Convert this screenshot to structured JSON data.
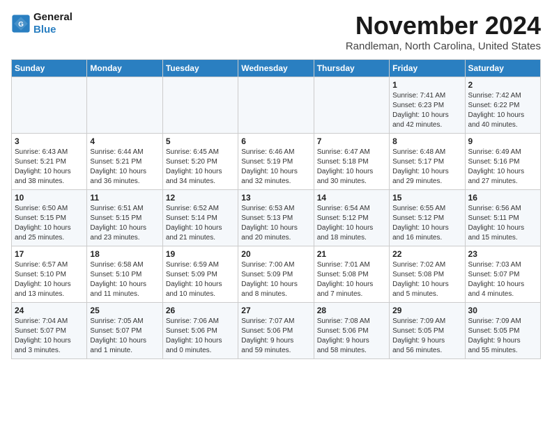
{
  "logo": {
    "line1": "General",
    "line2": "Blue"
  },
  "title": "November 2024",
  "location": "Randleman, North Carolina, United States",
  "days_of_week": [
    "Sunday",
    "Monday",
    "Tuesday",
    "Wednesday",
    "Thursday",
    "Friday",
    "Saturday"
  ],
  "weeks": [
    [
      {
        "day": "",
        "info": ""
      },
      {
        "day": "",
        "info": ""
      },
      {
        "day": "",
        "info": ""
      },
      {
        "day": "",
        "info": ""
      },
      {
        "day": "",
        "info": ""
      },
      {
        "day": "1",
        "info": "Sunrise: 7:41 AM\nSunset: 6:23 PM\nDaylight: 10 hours\nand 42 minutes."
      },
      {
        "day": "2",
        "info": "Sunrise: 7:42 AM\nSunset: 6:22 PM\nDaylight: 10 hours\nand 40 minutes."
      }
    ],
    [
      {
        "day": "3",
        "info": "Sunrise: 6:43 AM\nSunset: 5:21 PM\nDaylight: 10 hours\nand 38 minutes."
      },
      {
        "day": "4",
        "info": "Sunrise: 6:44 AM\nSunset: 5:21 PM\nDaylight: 10 hours\nand 36 minutes."
      },
      {
        "day": "5",
        "info": "Sunrise: 6:45 AM\nSunset: 5:20 PM\nDaylight: 10 hours\nand 34 minutes."
      },
      {
        "day": "6",
        "info": "Sunrise: 6:46 AM\nSunset: 5:19 PM\nDaylight: 10 hours\nand 32 minutes."
      },
      {
        "day": "7",
        "info": "Sunrise: 6:47 AM\nSunset: 5:18 PM\nDaylight: 10 hours\nand 30 minutes."
      },
      {
        "day": "8",
        "info": "Sunrise: 6:48 AM\nSunset: 5:17 PM\nDaylight: 10 hours\nand 29 minutes."
      },
      {
        "day": "9",
        "info": "Sunrise: 6:49 AM\nSunset: 5:16 PM\nDaylight: 10 hours\nand 27 minutes."
      }
    ],
    [
      {
        "day": "10",
        "info": "Sunrise: 6:50 AM\nSunset: 5:15 PM\nDaylight: 10 hours\nand 25 minutes."
      },
      {
        "day": "11",
        "info": "Sunrise: 6:51 AM\nSunset: 5:15 PM\nDaylight: 10 hours\nand 23 minutes."
      },
      {
        "day": "12",
        "info": "Sunrise: 6:52 AM\nSunset: 5:14 PM\nDaylight: 10 hours\nand 21 minutes."
      },
      {
        "day": "13",
        "info": "Sunrise: 6:53 AM\nSunset: 5:13 PM\nDaylight: 10 hours\nand 20 minutes."
      },
      {
        "day": "14",
        "info": "Sunrise: 6:54 AM\nSunset: 5:12 PM\nDaylight: 10 hours\nand 18 minutes."
      },
      {
        "day": "15",
        "info": "Sunrise: 6:55 AM\nSunset: 5:12 PM\nDaylight: 10 hours\nand 16 minutes."
      },
      {
        "day": "16",
        "info": "Sunrise: 6:56 AM\nSunset: 5:11 PM\nDaylight: 10 hours\nand 15 minutes."
      }
    ],
    [
      {
        "day": "17",
        "info": "Sunrise: 6:57 AM\nSunset: 5:10 PM\nDaylight: 10 hours\nand 13 minutes."
      },
      {
        "day": "18",
        "info": "Sunrise: 6:58 AM\nSunset: 5:10 PM\nDaylight: 10 hours\nand 11 minutes."
      },
      {
        "day": "19",
        "info": "Sunrise: 6:59 AM\nSunset: 5:09 PM\nDaylight: 10 hours\nand 10 minutes."
      },
      {
        "day": "20",
        "info": "Sunrise: 7:00 AM\nSunset: 5:09 PM\nDaylight: 10 hours\nand 8 minutes."
      },
      {
        "day": "21",
        "info": "Sunrise: 7:01 AM\nSunset: 5:08 PM\nDaylight: 10 hours\nand 7 minutes."
      },
      {
        "day": "22",
        "info": "Sunrise: 7:02 AM\nSunset: 5:08 PM\nDaylight: 10 hours\nand 5 minutes."
      },
      {
        "day": "23",
        "info": "Sunrise: 7:03 AM\nSunset: 5:07 PM\nDaylight: 10 hours\nand 4 minutes."
      }
    ],
    [
      {
        "day": "24",
        "info": "Sunrise: 7:04 AM\nSunset: 5:07 PM\nDaylight: 10 hours\nand 3 minutes."
      },
      {
        "day": "25",
        "info": "Sunrise: 7:05 AM\nSunset: 5:07 PM\nDaylight: 10 hours\nand 1 minute."
      },
      {
        "day": "26",
        "info": "Sunrise: 7:06 AM\nSunset: 5:06 PM\nDaylight: 10 hours\nand 0 minutes."
      },
      {
        "day": "27",
        "info": "Sunrise: 7:07 AM\nSunset: 5:06 PM\nDaylight: 9 hours\nand 59 minutes."
      },
      {
        "day": "28",
        "info": "Sunrise: 7:08 AM\nSunset: 5:06 PM\nDaylight: 9 hours\nand 58 minutes."
      },
      {
        "day": "29",
        "info": "Sunrise: 7:09 AM\nSunset: 5:05 PM\nDaylight: 9 hours\nand 56 minutes."
      },
      {
        "day": "30",
        "info": "Sunrise: 7:09 AM\nSunset: 5:05 PM\nDaylight: 9 hours\nand 55 minutes."
      }
    ]
  ]
}
